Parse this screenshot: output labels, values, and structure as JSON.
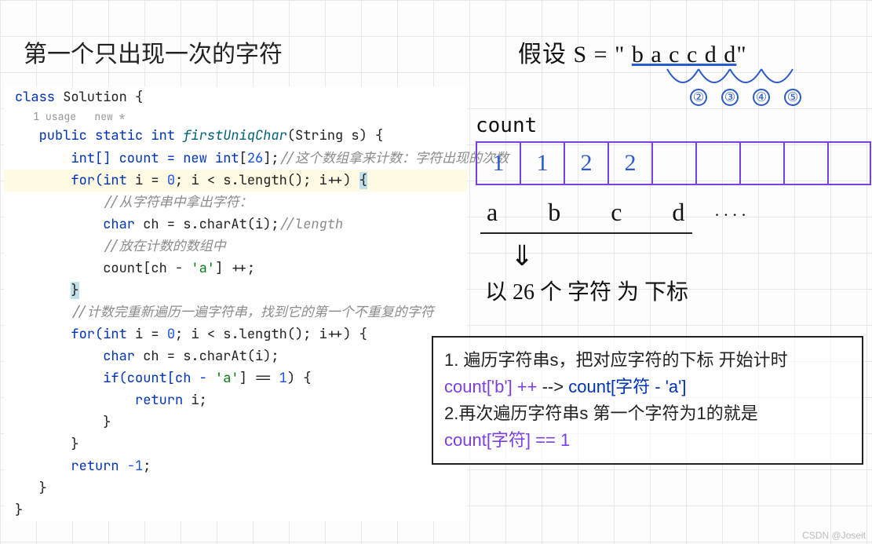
{
  "title": "第一个只出现一次的字符",
  "code": {
    "l1_a": "class ",
    "l1_b": "Solution {",
    "hint": "1 usage   new *",
    "l2_a": "public static int ",
    "l2_fn": "firstUniqChar",
    "l2_b": "(String s) {",
    "l3_a": "int[] count = ",
    "l3_b": "new int",
    "l3_c": "[",
    "l3_n": "26",
    "l3_d": "];",
    "l3_cm": "//这个数组拿来计数：字符出现的次数",
    "l4_a": "for(",
    "l4_b": "int ",
    "l4_c": "i = ",
    "l4_n0": "0",
    "l4_d": "; i < s.length(); i++) ",
    "l4_brace": "{",
    "l5_cm": "//从字符串中拿出字符：",
    "l6_a": "char ",
    "l6_b": "ch = s.charAt(i);",
    "l6_cm": "//length",
    "l7_cm": "//放在计数的数组中",
    "l8": "count[ch - ",
    "l8_s": "'a'",
    "l8_b": "] ++;",
    "l9": "}",
    "l10_cm": "//计数完重新遍历一遍字符串，找到它的第一个不重复的字符",
    "l11_a": "for(",
    "l11_b": "int ",
    "l11_c": "i = ",
    "l11_n0": "0",
    "l11_d": "; i < s.length(); i++) {",
    "l12_a": "char ",
    "l12_b": "ch = s.charAt(i);",
    "l13_a": "if(count[ch - ",
    "l13_s": "'a'",
    "l13_b": "] == ",
    "l13_n": "1",
    "l13_c": ") {",
    "l14_a": "return ",
    "l14_b": "i;",
    "l15": "}",
    "l16": "}",
    "l17_a": "return ",
    "l17_n": "-1",
    "l17_b": ";",
    "l18": "}",
    "l19": "}"
  },
  "right": {
    "assumption_a": "假设  S = \" ",
    "assumption_b": "b a c c d d",
    "assumption_c": "\"",
    "circles": [
      "②",
      "③",
      "④",
      "⑤"
    ],
    "count_label": "count",
    "cells": [
      "1",
      "1",
      "2",
      "2",
      "",
      "",
      "",
      "",
      "",
      ""
    ],
    "letters": "a  b  c  d",
    "dots": " ····",
    "arrow": "⇓",
    "subscript": "以 26 个 字符 为 下标"
  },
  "note": {
    "l1": "1. 遍历字符串s，把对应字符的下标 开始计时",
    "l2a": "count['b'] ++ ",
    "l2b": "--> ",
    "l2c": "count[字符 - 'a']",
    "l3": "2.再次遍历字符串s 第一个字符为1的就是",
    "l4": "count[字符] == 1"
  },
  "watermark": "CSDN @Joseit"
}
